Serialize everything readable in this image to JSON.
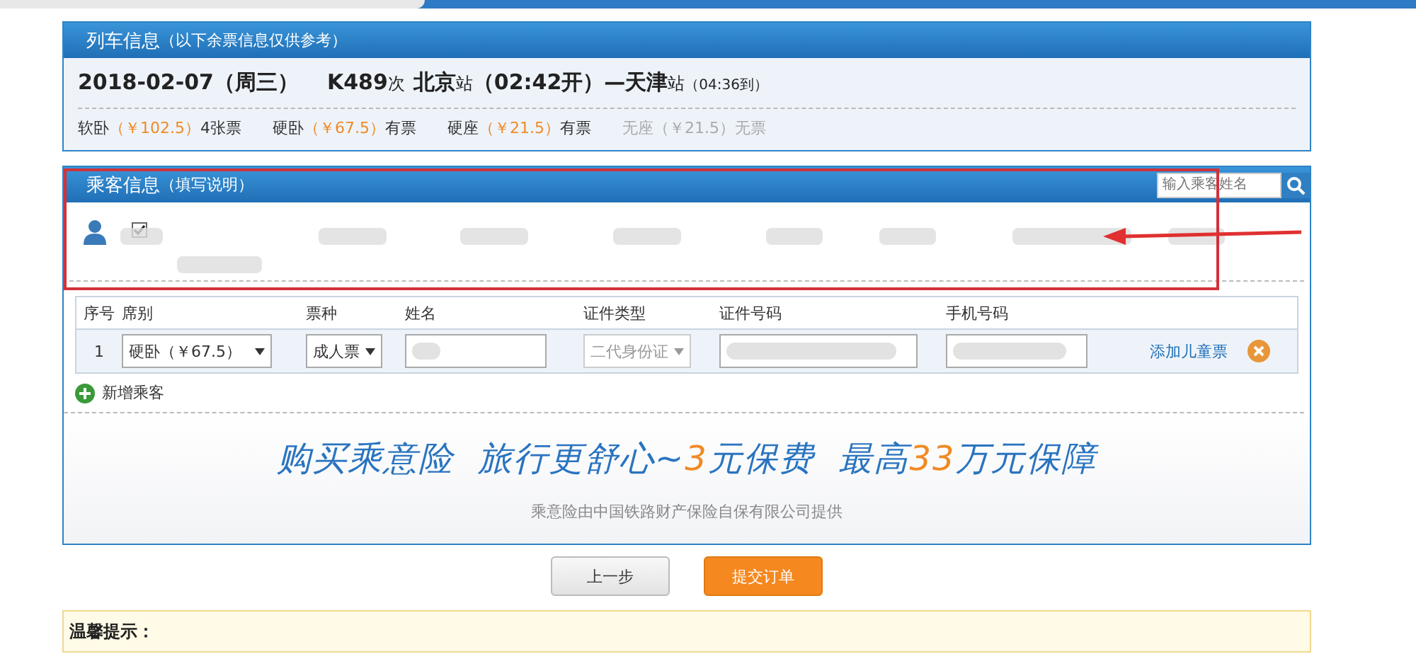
{
  "train_panel": {
    "title": "列车信息",
    "note": "（以下余票信息仅供参考）",
    "date": "2018-02-07（周三）",
    "train_no": "K489",
    "train_suffix": "次",
    "from": "北京",
    "from_suffix": "站",
    "depart": "（02:42开）",
    "dash": "—",
    "to": "天津",
    "to_suffix": "站",
    "arrive": "（04:36到）",
    "seats": [
      {
        "name": "软卧",
        "price": "（￥102.5）",
        "count": "4张票",
        "available": true
      },
      {
        "name": "硬卧",
        "price": "（￥67.5）",
        "count": "有票",
        "available": true
      },
      {
        "name": "硬座",
        "price": "（￥21.5）",
        "count": "有票",
        "available": true
      },
      {
        "name": "无座",
        "price": "（￥21.5）",
        "count": "无票",
        "available": false
      }
    ]
  },
  "passenger_panel": {
    "title": "乘客信息",
    "note": "（填写说明）",
    "search": {
      "placeholder": "输入乘客姓名"
    },
    "saved_passenger": {
      "checked": true
    },
    "columns": [
      "序号",
      "席别",
      "票种",
      "姓名",
      "证件类型",
      "证件号码",
      "手机号码"
    ],
    "rows": [
      {
        "index": "1",
        "seat": "硬卧（￥67.5）",
        "ticket_type": "成人票",
        "id_type": "二代身份证",
        "id_type_disabled": true,
        "add_child": "添加儿童票"
      }
    ],
    "add_passenger": "新增乘客",
    "banner": {
      "headline": [
        {
          "text": "购买乘意险  旅行更舒心~",
          "accent": false
        },
        {
          "text": "3",
          "accent": true
        },
        {
          "text": "元保费  最高",
          "accent": false
        },
        {
          "text": "33",
          "accent": true
        },
        {
          "text": "万元保障",
          "accent": false
        }
      ],
      "subtitle": "乘意险由中国铁路财产保险自保有限公司提供"
    }
  },
  "buttons": [
    {
      "label": "上一步",
      "kind": "secondary"
    },
    {
      "label": "提交订单",
      "kind": "primary"
    }
  ],
  "tips": {
    "title": "温馨提示："
  }
}
